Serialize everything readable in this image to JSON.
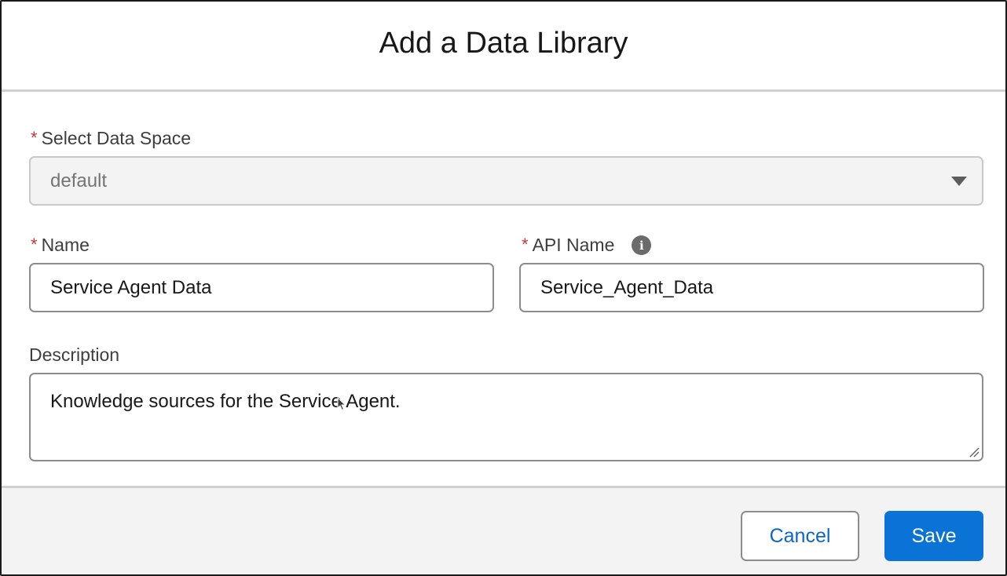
{
  "dialog": {
    "title": "Add a Data Library"
  },
  "form": {
    "data_space": {
      "label": "Select Data Space",
      "required_marker": "*",
      "value": "default"
    },
    "name": {
      "label": "Name",
      "required_marker": "*",
      "value": "Service Agent Data"
    },
    "api_name": {
      "label": "API Name",
      "required_marker": "*",
      "value": "Service_Agent_Data",
      "info_icon": "info-icon",
      "info_glyph": "i"
    },
    "description": {
      "label": "Description",
      "value": "Knowledge sources for the Service Agent."
    }
  },
  "footer": {
    "cancel_label": "Cancel",
    "save_label": "Save"
  },
  "colors": {
    "brand_button": "#0b73d6",
    "link_text": "#0b66c9",
    "required": "#c23934"
  }
}
